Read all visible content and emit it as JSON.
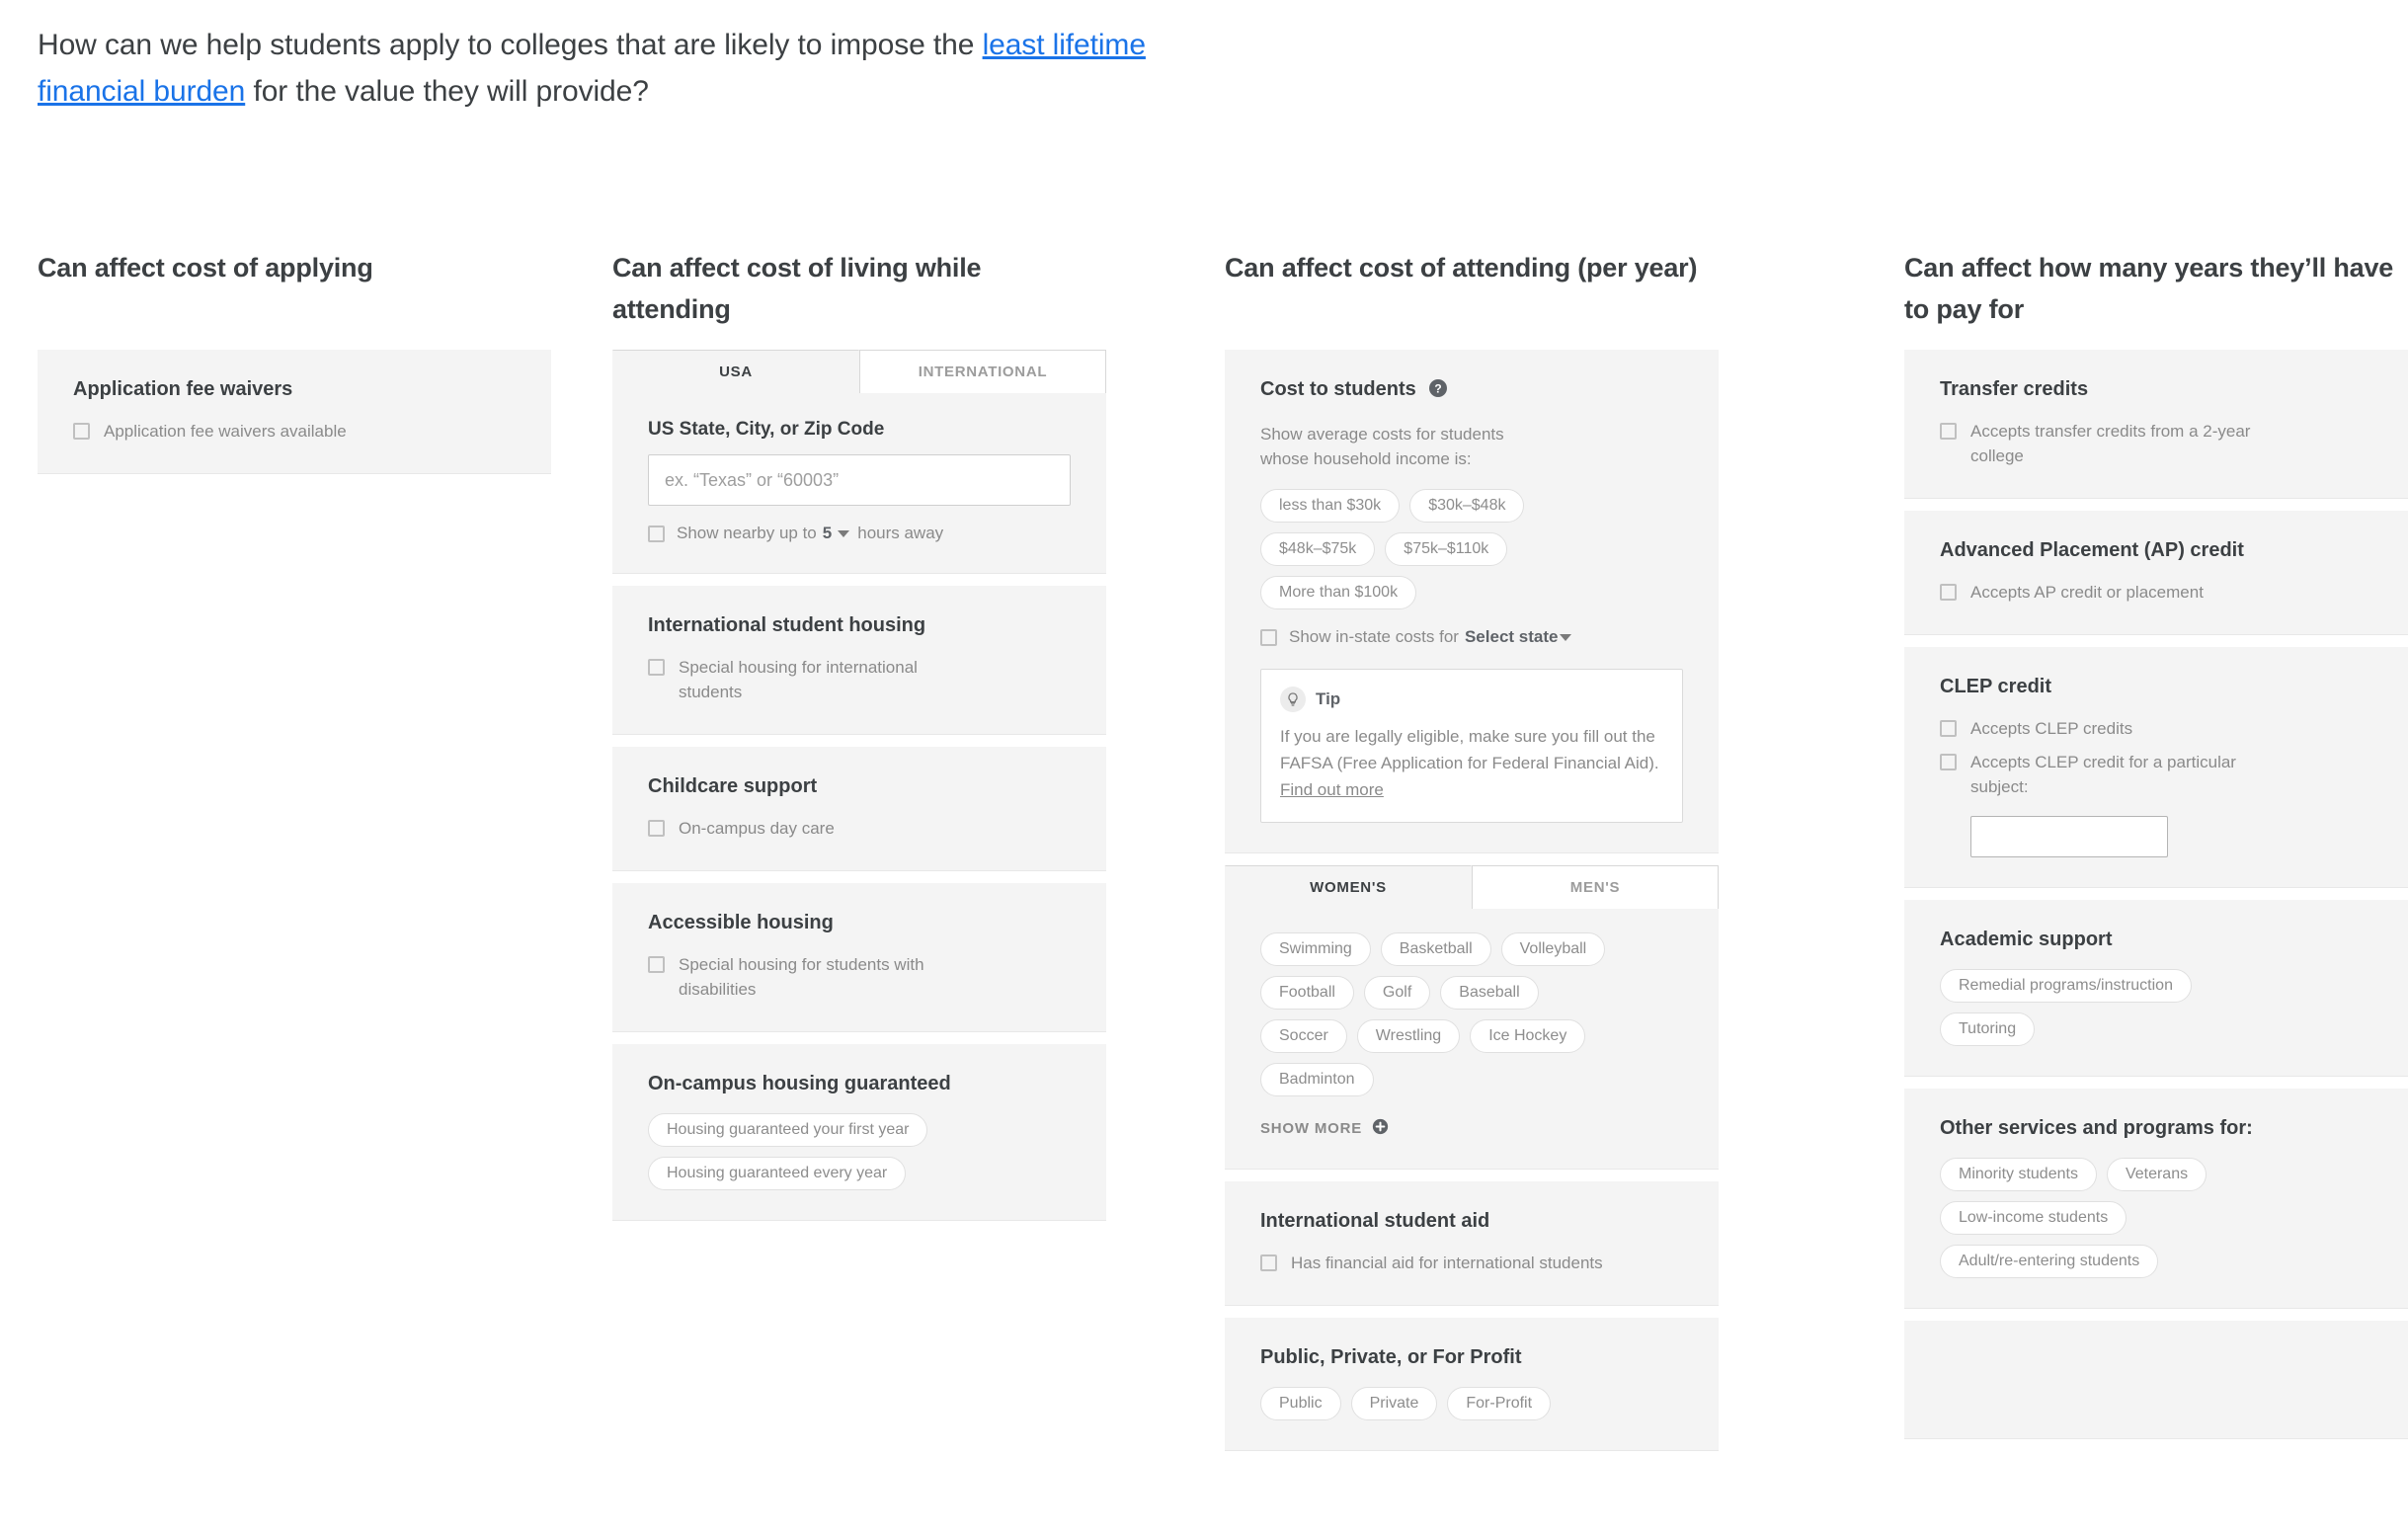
{
  "headline": {
    "part1": "How can we help students apply to colleges that are likely to impose the ",
    "link": "least lifetime financial burden",
    "part2": " for the value they will provide?"
  },
  "columns": [
    {
      "id": "cost-of-applying",
      "title": "Can affect cost of applying",
      "cards": [
        {
          "id": "application-fee-waivers",
          "title": "Application fee waivers",
          "checkboxes": [
            "Application fee waivers available"
          ]
        }
      ]
    },
    {
      "id": "cost-of-living",
      "title": "Can affect cost of living while attending",
      "cards": [
        {
          "id": "location",
          "type": "tabs",
          "tabs": [
            {
              "label": "USA",
              "active": true
            },
            {
              "label": "INTERNATIONAL",
              "active": false
            }
          ],
          "field_label": "US State, City, or Zip Code",
          "input_placeholder": "ex. “Texas” or “60003”",
          "input_value": "",
          "nearby_prefix": "Show nearby up to",
          "nearby_value": "5",
          "nearby_suffix": "hours away"
        },
        {
          "id": "international-student-housing",
          "title": "International student housing",
          "checkboxes": [
            "Special housing for international students"
          ]
        },
        {
          "id": "childcare-support",
          "title": "Childcare support",
          "checkboxes": [
            "On-campus day care"
          ]
        },
        {
          "id": "accessible-housing",
          "title": "Accessible housing",
          "checkboxes": [
            "Special housing for students with disabilities"
          ]
        },
        {
          "id": "on-campus-housing-guaranteed",
          "title": "On-campus housing guaranteed",
          "chips": [
            "Housing guaranteed your first year",
            "Housing guaranteed every year"
          ]
        }
      ]
    },
    {
      "id": "cost-of-attending",
      "title": "Can affect cost of attending (per year)",
      "cards": [
        {
          "id": "cost-to-students",
          "title": "Cost to students",
          "has_help_icon": true,
          "subtitle": "Show average costs for students whose household income is:",
          "chips": [
            "less than $30k",
            "$30k–$48k",
            "$48k–$75k",
            "$75k–$110k",
            "More than $100k"
          ],
          "instate_label": "Show in-state costs for",
          "instate_select": "Select state",
          "tip": {
            "label": "Tip",
            "text": "If you are legally eligible, make sure you fill out the FAFSA (Free Application for Federal Financial Aid). ",
            "link": "Find out more"
          }
        },
        {
          "id": "sports",
          "type": "tabs",
          "tabs": [
            {
              "label": "WOMEN'S",
              "active": true
            },
            {
              "label": "MEN'S",
              "active": false
            }
          ],
          "chips": [
            "Swimming",
            "Basketball",
            "Volleyball",
            "Football",
            "Golf",
            "Baseball",
            "Soccer",
            "Wrestling",
            "Ice Hockey",
            "Badminton"
          ],
          "show_more": "SHOW MORE"
        },
        {
          "id": "international-student-aid",
          "title": "International student aid",
          "checkboxes": [
            "Has financial aid for international students"
          ]
        },
        {
          "id": "public-private-for-profit",
          "title": "Public, Private, or For Profit",
          "chips": [
            "Public",
            "Private",
            "For-Profit"
          ]
        }
      ]
    },
    {
      "id": "years-to-pay-for",
      "title": "Can affect how many years they’ll have to pay for",
      "cards": [
        {
          "id": "transfer-credits",
          "title": "Transfer credits",
          "checkboxes": [
            "Accepts transfer credits from a 2-year college"
          ]
        },
        {
          "id": "ap-credit",
          "title": "Advanced Placement (AP) credit",
          "checkboxes": [
            "Accepts AP credit or placement"
          ]
        },
        {
          "id": "clep-credit",
          "title": "CLEP credit",
          "checkboxes": [
            "Accepts CLEP credits",
            "Accepts CLEP credit for a particular subject:"
          ],
          "subject_input_value": ""
        },
        {
          "id": "academic-support",
          "title": "Academic support",
          "chips": [
            "Remedial programs/instruction",
            "Tutoring"
          ]
        },
        {
          "id": "other-services",
          "title": "Other services and programs for:",
          "chips": [
            "Minority students",
            "Veterans",
            "Low-income students",
            "Adult/re-entering students"
          ]
        }
      ]
    }
  ],
  "colors": {
    "link": "#1a73e8",
    "text": "#3c4043",
    "muted": "#8a8a8a",
    "card_bg": "#f4f4f4"
  }
}
